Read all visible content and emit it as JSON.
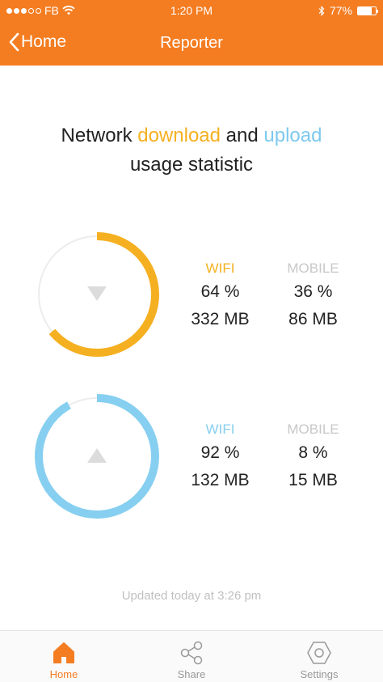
{
  "status_bar": {
    "carrier": "FB",
    "time": "1:20 PM",
    "battery": "77%",
    "battery_level": 0.77,
    "signal_bars_filled": 3,
    "signal_bars_total": 5
  },
  "nav": {
    "back_label": "Home",
    "title": "Reporter"
  },
  "headline": {
    "part1": "Network ",
    "download": "download",
    "part2": " and ",
    "upload": "upload",
    "line2": "usage statistic"
  },
  "download": {
    "wifi_label": "WIFI",
    "mobile_label": "MOBILE",
    "wifi_percent": "64 %",
    "mobile_percent": "36 %",
    "wifi_mb": "332 MB",
    "mobile_mb": "86 MB",
    "wifi_fraction": 0.64,
    "color": "#f5b021"
  },
  "upload": {
    "wifi_label": "WIFI",
    "mobile_label": "MOBILE",
    "wifi_percent": "92 %",
    "mobile_percent": "8 %",
    "wifi_mb": "132 MB",
    "mobile_mb": "15 MB",
    "wifi_fraction": 0.92,
    "color": "#87cff0"
  },
  "updated_text": "Updated today at 3:26 pm",
  "tabs": [
    {
      "label": "Home",
      "icon": "home-icon",
      "active": true
    },
    {
      "label": "Share",
      "icon": "share-icon",
      "active": false
    },
    {
      "label": "Settings",
      "icon": "settings-icon",
      "active": false
    }
  ],
  "colors": {
    "accent": "#f47d22",
    "download": "#f5b021",
    "upload": "#87cff0",
    "muted": "#c0c0c0"
  }
}
